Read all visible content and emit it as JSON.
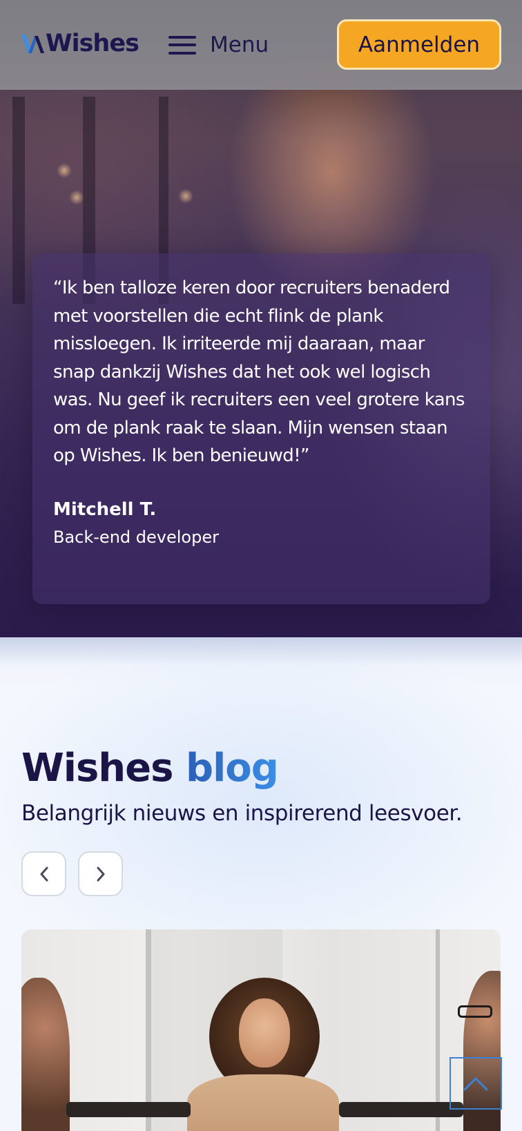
{
  "header": {
    "logo_text": "Wishes",
    "menu_label": "Menu",
    "signup_label": "Aanmelden"
  },
  "testimonial": {
    "quote": "“Ik ben talloze keren door recruiters benaderd met voorstellen die echt flink de plank missloegen. Ik irriteerde mij daaraan, maar snap dankzij Wishes dat het ook wel logisch was. Nu geef ik recruiters een veel grotere kans om de plank raak te slaan. Mijn wensen staan op Wishes. Ik ben benieuwd!”",
    "author": "Mitchell T.",
    "role": "Back-end developer"
  },
  "blog": {
    "title_main": "Wishes",
    "title_accent": "blog",
    "subtitle": "Belangrijk nieuws en inspirerend leesvoer."
  },
  "icons": {
    "menu": "hamburger-icon",
    "prev": "chevron-left-icon",
    "next": "chevron-right-icon",
    "scroll_top": "chevron-up-icon"
  },
  "colors": {
    "brand_navy": "#1b1446",
    "accent_orange": "#f5a623",
    "accent_blue": "#3b8ee6"
  }
}
